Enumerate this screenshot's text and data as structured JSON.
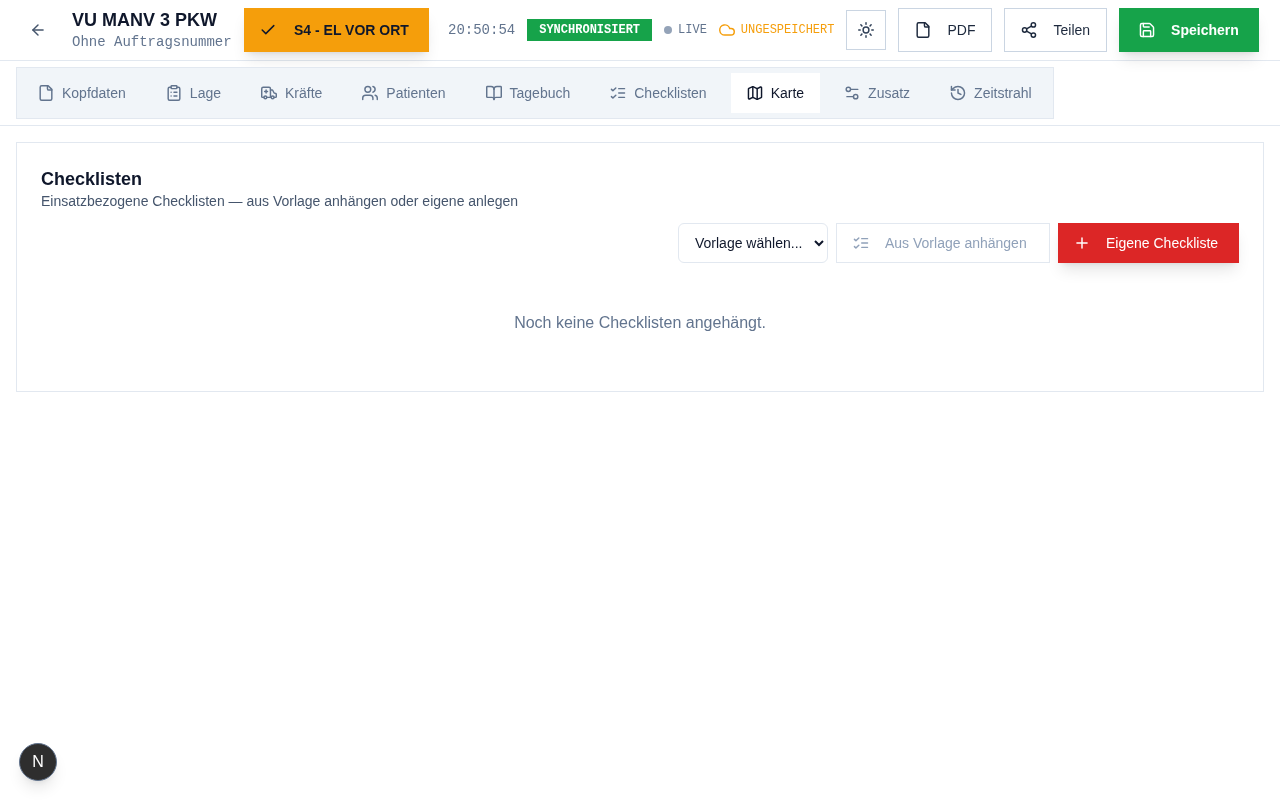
{
  "header": {
    "title": "VU MANV 3 PKW",
    "subtitle": "Ohne Auftragsnummer",
    "status_button": {
      "label": "S4 - EL VOR ORT"
    },
    "clock": "20:50:54",
    "sync_badge": "SYNCHRONISIERT",
    "live": {
      "label": "LIVE",
      "active": false
    },
    "save_state": "UNGESPEICHERT",
    "pdf_button": {
      "label": "PDF"
    },
    "share_button": {
      "label": "Teilen"
    },
    "save_button": {
      "label": "Speichern"
    }
  },
  "tabs": [
    {
      "label": "Kopfdaten",
      "selected": false
    },
    {
      "label": "Lage",
      "selected": false
    },
    {
      "label": "Kräfte",
      "selected": false
    },
    {
      "label": "Patienten",
      "selected": false
    },
    {
      "label": "Tagebuch",
      "selected": false
    },
    {
      "label": "Checklisten",
      "selected": false
    },
    {
      "label": "Karte",
      "selected": true
    },
    {
      "label": "Zusatz",
      "selected": false
    },
    {
      "label": "Zeitstrahl",
      "selected": false
    }
  ],
  "checklists": {
    "title": "Checklisten",
    "description": "Einsatzbezogene Checklisten — aus Vorlage anhängen oder eigene anlegen",
    "template_select": {
      "value": "Vorlage wählen..."
    },
    "attach_button": {
      "label": "Aus Vorlage anhängen",
      "disabled": true
    },
    "add_button": {
      "label": "Eigene Checkliste"
    },
    "empty_message": "Noch keine Checklisten angehängt."
  },
  "dev_badge": {
    "label": "N"
  }
}
